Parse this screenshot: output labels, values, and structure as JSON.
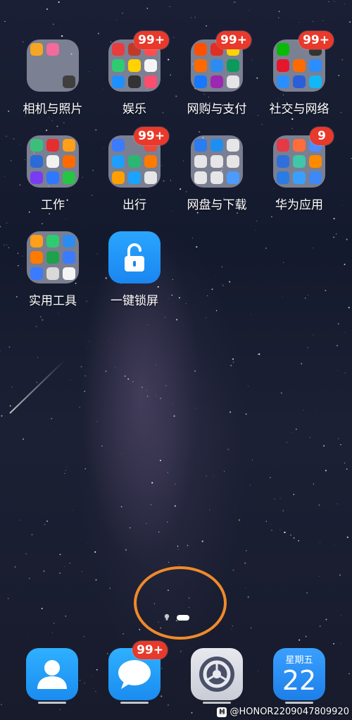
{
  "folders": [
    {
      "label": "相机与照片",
      "badge": "",
      "colors": [
        "#3f3f3f",
        "#f5a623",
        "#f26b9c",
        "#ffffff",
        "#ffffff",
        "#ffffff",
        "#ffffff",
        "#ffffff",
        "#ffffff"
      ]
    },
    {
      "label": "娱乐",
      "badge": "99+",
      "colors": [
        "#e93c3c",
        "#c0392b",
        "#ff4d4f",
        "#2ecc71",
        "#ffd200",
        "#f5f5f5",
        "#1e90ff",
        "#333333",
        "#ff4d6d"
      ]
    },
    {
      "label": "网购与支付",
      "badge": "99+",
      "colors": [
        "#ff5000",
        "#e02e24",
        "#ffd400",
        "#ff6a00",
        "#2d8cf0",
        "#0a9a5c",
        "#1677ff",
        "#9c27b0",
        "#e5e5e5"
      ]
    },
    {
      "label": "社交与网络",
      "badge": "99+",
      "colors": [
        "#09bb07",
        "#ffffff",
        "#333333",
        "#e6162d",
        "#ff6b00",
        "#2b8eff",
        "#2b8eff",
        "#2b5fd9",
        "#12b7f5"
      ]
    },
    {
      "label": "工作",
      "badge": "",
      "colors": [
        "#28c445",
        "#3bc07c",
        "#e52e2e",
        "#ff9f1a",
        "#2b6bd8",
        "#f1f1f1",
        "#ff6a00",
        "#7a3cf0",
        "#2d78ff"
      ]
    },
    {
      "label": "出行",
      "badge": "99+",
      "colors": [
        "#3a7bff",
        "#ffffff",
        "#e84a3c",
        "#1e9fff",
        "#2bb673",
        "#ff7a00",
        "#ff9f00",
        "#1aa3ff",
        "#e6e6e6"
      ]
    },
    {
      "label": "网盘与下载",
      "badge": "",
      "colors": [
        "#4c9bff",
        "#2b7cf0",
        "#1f8ef1",
        "#e6e6e6",
        "#e6e6e6",
        "#e6e6e6",
        "#e6e6e6",
        "#e6e6e6",
        "#e6e6e6"
      ]
    },
    {
      "label": "华为应用",
      "badge": "9",
      "colors": [
        "#e63946",
        "#ff6d3b",
        "#4f8cff",
        "#2f6fd9",
        "#3fc7a8",
        "#ff8a00",
        "#2b7be4",
        "#3aa0ff",
        "#3d89f5"
      ]
    },
    {
      "label": "实用工具",
      "badge": "",
      "colors": [
        "#f4f4f4",
        "#ff9f1a",
        "#2ecc71",
        "#2d8cf0",
        "#ff7a00",
        "#1ea14b",
        "#3a7bff",
        "#3a7bff",
        "#d9d9d9"
      ]
    }
  ],
  "lock_app": {
    "label": "一键锁屏"
  },
  "dock": {
    "contacts": {
      "icon": "contacts-icon"
    },
    "messages": {
      "icon": "messages-icon",
      "badge": "99+"
    },
    "settings": {
      "icon": "settings-icon"
    },
    "calendar": {
      "weekday": "星期五",
      "day": "22"
    }
  },
  "watermark": {
    "brand": "H",
    "text": "@HONOR2209047809920"
  }
}
